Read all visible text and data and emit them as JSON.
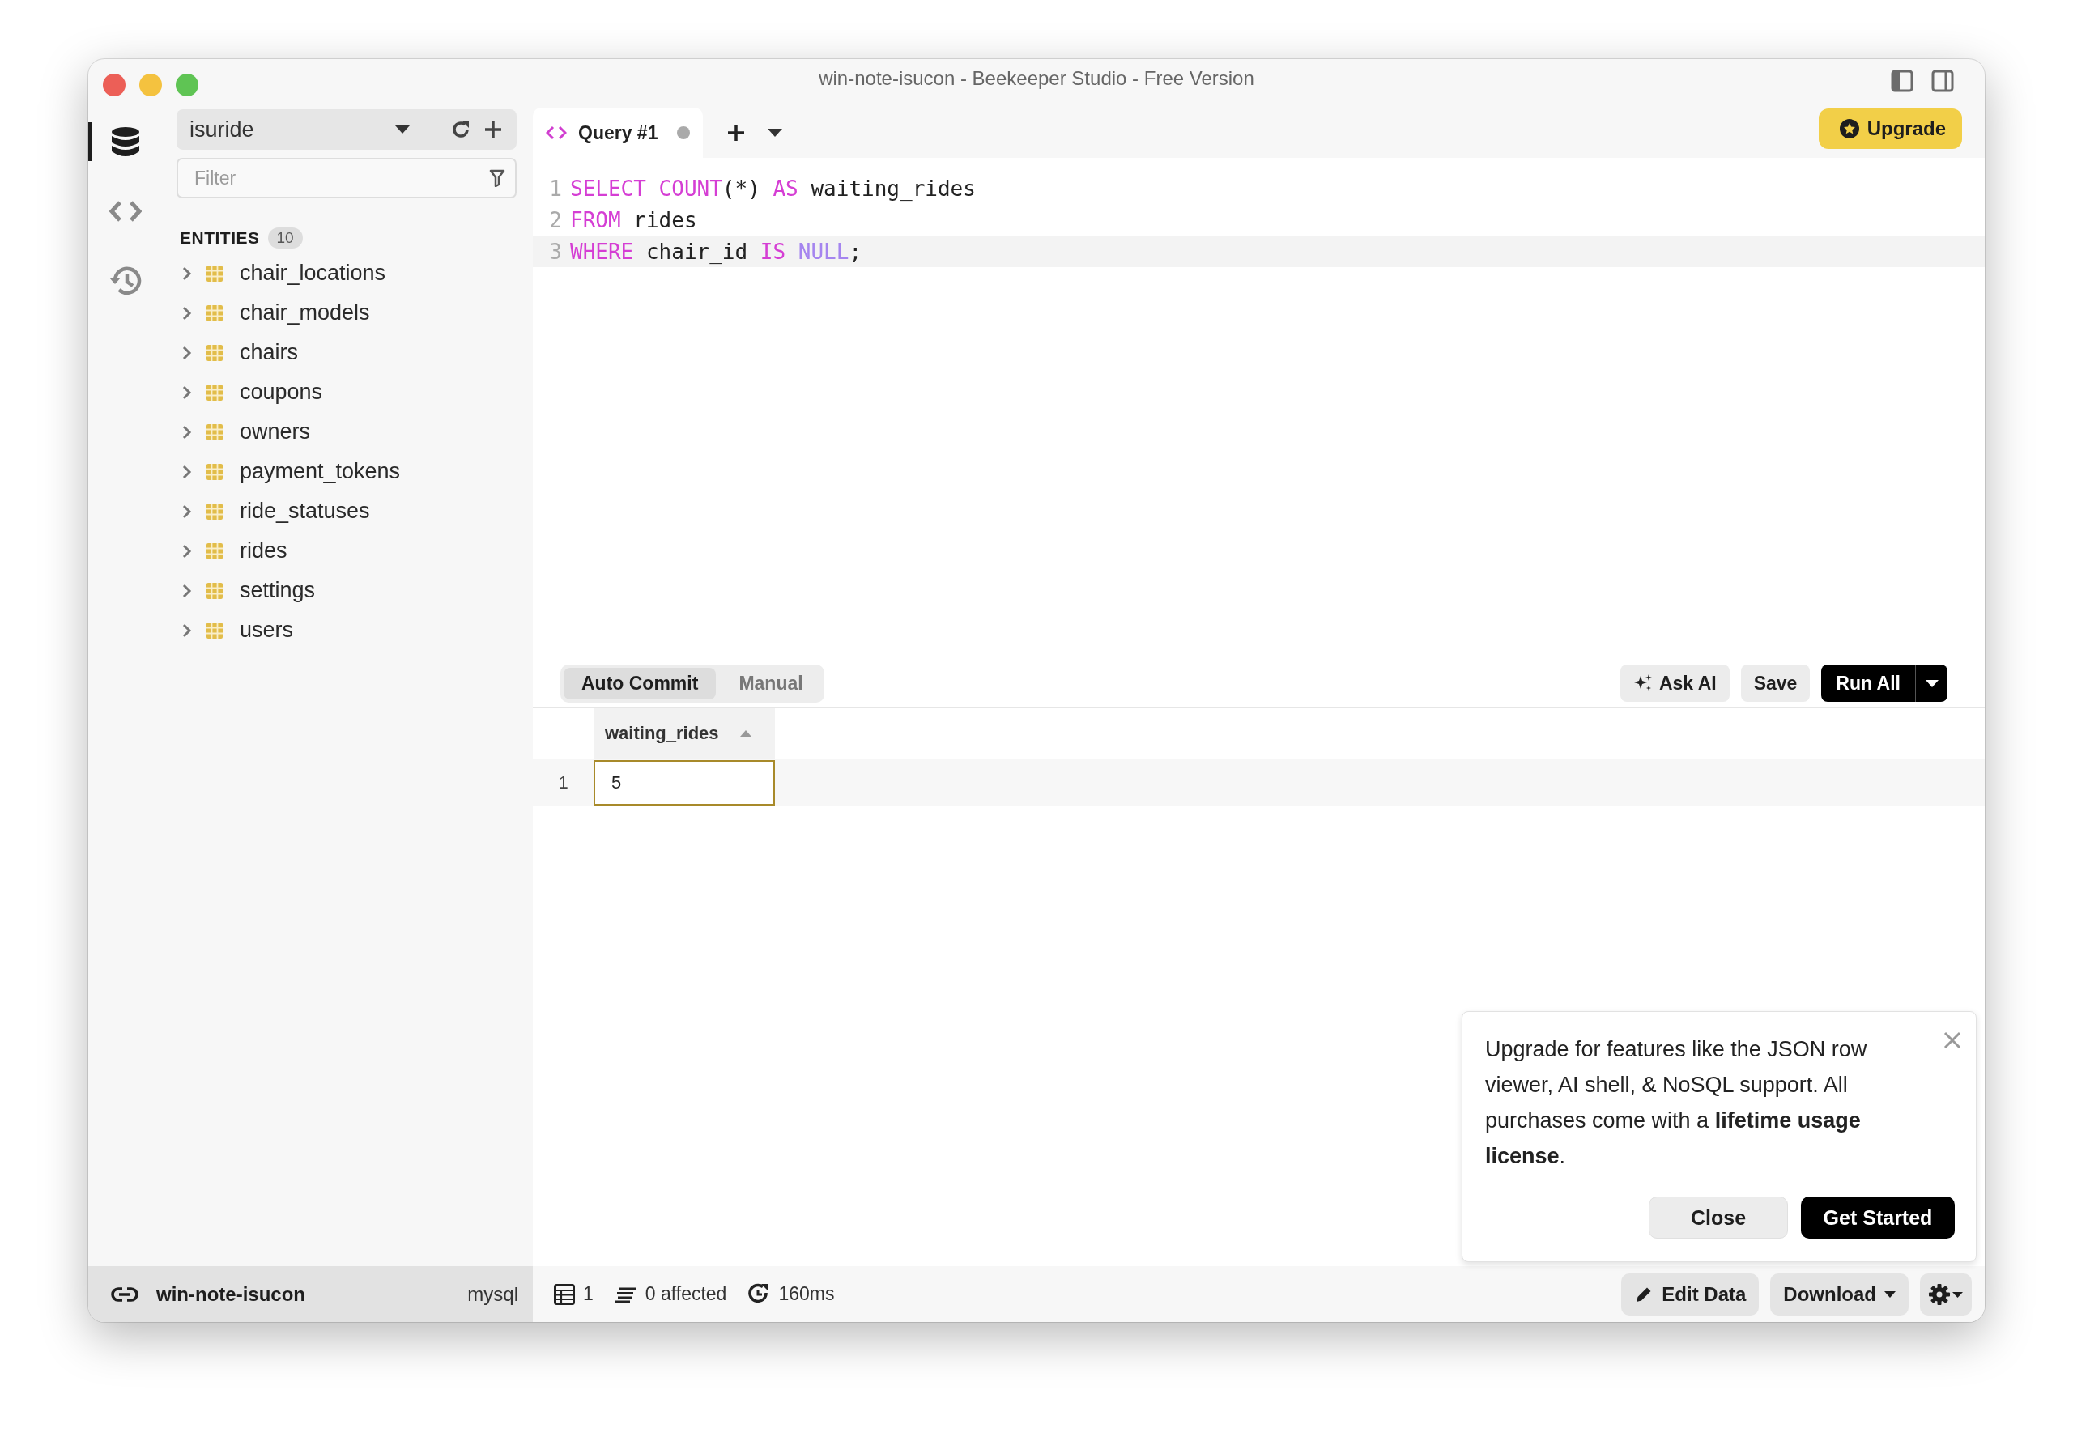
{
  "window": {
    "title": "win-note-isucon - Beekeeper Studio - Free Version"
  },
  "rail": [
    {
      "kind": "database",
      "selected": true
    },
    {
      "kind": "code",
      "selected": false
    },
    {
      "kind": "history",
      "selected": false
    }
  ],
  "connection": {
    "database": "isuride"
  },
  "filter": {
    "placeholder": "Filter"
  },
  "entities": {
    "label": "ENTITIES",
    "count": "10",
    "items": [
      {
        "name": "chair_locations",
        "expanded": false
      },
      {
        "name": "chair_models",
        "expanded": false
      },
      {
        "name": "chairs",
        "expanded": false
      },
      {
        "name": "coupons",
        "expanded": false
      },
      {
        "name": "owners",
        "expanded": false
      },
      {
        "name": "payment_tokens",
        "expanded": false
      },
      {
        "name": "ride_statuses",
        "expanded": false
      },
      {
        "name": "rides",
        "expanded": false
      },
      {
        "name": "settings",
        "expanded": false
      },
      {
        "name": "users",
        "expanded": false
      }
    ]
  },
  "tabs": [
    {
      "label": "Query #1",
      "selected": true,
      "unsaved": true
    }
  ],
  "upgrade_button": "Upgrade",
  "editor": {
    "lines": [
      {
        "number": "1",
        "active": false,
        "tokens": [
          {
            "text": "SELECT",
            "kind": "keyword"
          },
          {
            "text": " COUNT",
            "kind": "keyword"
          },
          {
            "text": "(*) ",
            "kind": "plain"
          },
          {
            "text": "AS",
            "kind": "keyword"
          },
          {
            "text": " waiting_rides",
            "kind": "plain"
          }
        ]
      },
      {
        "number": "2",
        "active": false,
        "tokens": [
          {
            "text": "FROM",
            "kind": "keyword"
          },
          {
            "text": " rides",
            "kind": "plain"
          }
        ]
      },
      {
        "number": "3",
        "active": true,
        "tokens": [
          {
            "text": "WHERE",
            "kind": "keyword"
          },
          {
            "text": " chair_id ",
            "kind": "plain"
          },
          {
            "text": "IS",
            "kind": "keyword"
          },
          {
            "text": " NULL",
            "kind": "literal"
          },
          {
            "text": ";",
            "kind": "plain"
          }
        ]
      }
    ]
  },
  "commit_modes": [
    {
      "label": "Auto Commit",
      "selected": true
    },
    {
      "label": "Manual",
      "selected": false
    }
  ],
  "actions": [
    {
      "label": "Ask AI",
      "kind": "ai"
    },
    {
      "label": "Save",
      "kind": "save"
    },
    {
      "label": "Run All",
      "kind": "run"
    }
  ],
  "results": {
    "columns": [
      {
        "label": "waiting_rides",
        "sort_ascending": true
      }
    ],
    "rows": [
      {
        "number": "1",
        "selected": true,
        "cells": [
          "5"
        ]
      }
    ]
  },
  "popup": {
    "message": "Upgrade for features like the JSON row viewer, AI shell, & NoSQL support. All purchases come with a **lifetime usage license**.",
    "buttons": [
      {
        "label": "Close",
        "kind": "secondary"
      },
      {
        "label": "Get Started",
        "kind": "primary"
      }
    ]
  },
  "status_bar": {
    "connection": "win-note-isucon",
    "driver": "mysql",
    "rows": "1",
    "affected": "0 affected",
    "time": "160ms",
    "buttons": [
      {
        "label": "Edit Data",
        "kind": "edit"
      },
      {
        "label": "Download",
        "kind": "download"
      }
    ]
  }
}
